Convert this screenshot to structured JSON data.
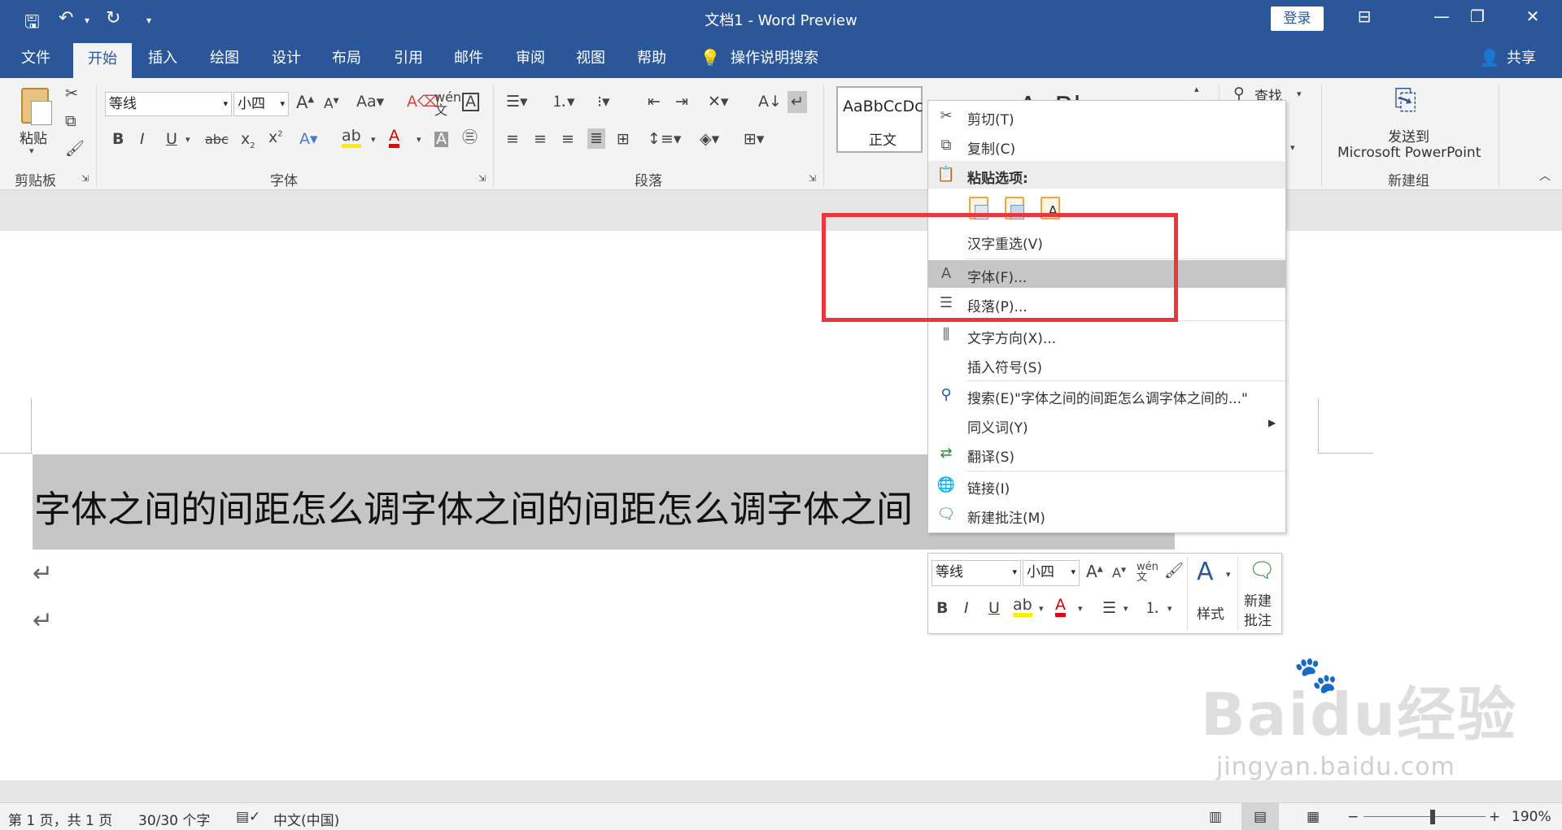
{
  "window": {
    "title": "文档1 - Word Preview",
    "login_label": "登录",
    "share_label": "共享"
  },
  "tabs": [
    "文件",
    "开始",
    "插入",
    "绘图",
    "设计",
    "布局",
    "引用",
    "邮件",
    "审阅",
    "视图",
    "帮助"
  ],
  "active_tab": "开始",
  "tell_me": "操作说明搜索",
  "ribbon": {
    "clipboard": {
      "paste_label": "粘贴",
      "group_label": "剪贴板"
    },
    "font": {
      "font_name": "等线",
      "font_size": "小四",
      "group_label": "字体"
    },
    "paragraph": {
      "group_label": "段落"
    },
    "styles": {
      "preview_text": "AaBbCcDc",
      "style_name": "正文",
      "preview_big": "AaBb"
    },
    "editing": {
      "find_label": "查找"
    },
    "send": {
      "label_line1": "发送到",
      "label_line2": "Microsoft PowerPoint",
      "group_label": "新建组"
    }
  },
  "document": {
    "line": "字体之间的间距怎么调字体之间的间距怎么调字体之间"
  },
  "context_menu": {
    "items": [
      {
        "label": "剪切(T)",
        "icon": "scissors-icon"
      },
      {
        "label": "复制(C)",
        "icon": "copy-icon"
      },
      {
        "label": "粘贴选项:",
        "icon": "paste-icon"
      },
      {
        "label": "汉字重选(V)",
        "icon": ""
      },
      {
        "label": "字体(F)...",
        "icon": "font-icon"
      },
      {
        "label": "段落(P)...",
        "icon": "paragraph-icon"
      },
      {
        "label": "文字方向(X)...",
        "icon": "text-direction-icon"
      },
      {
        "label": "插入符号(S)",
        "icon": ""
      },
      {
        "label": "搜索(E)\"字体之间的间距怎么调字体之间的...\"",
        "icon": "search-icon"
      },
      {
        "label": "同义词(Y)",
        "icon": ""
      },
      {
        "label": "翻译(S)",
        "icon": "translate-icon"
      },
      {
        "label": "链接(I)",
        "icon": "link-icon"
      },
      {
        "label": "新建批注(M)",
        "icon": "comment-icon"
      }
    ]
  },
  "mini_toolbar": {
    "font_name": "等线",
    "font_size": "小四",
    "styles_label": "样式",
    "new_comment_line1": "新建",
    "new_comment_line2": "批注"
  },
  "status": {
    "page": "第 1 页，共 1 页",
    "words": "30/30 个字",
    "language": "中文(中国)",
    "zoom": "190%"
  },
  "watermark": {
    "brand": "Baidu经验",
    "url": "jingyan.baidu.com"
  },
  "colors": {
    "title_blue": "#2b579a",
    "highlight_red": "#e8383d",
    "selection_gray": "#c6c6c6"
  }
}
